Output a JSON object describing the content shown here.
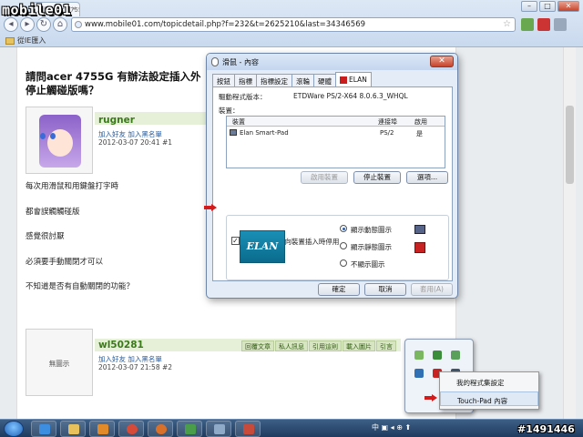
{
  "browser": {
    "logo_text": "mobile01",
    "tab_title": "請問acer 4755G 有辦法...",
    "address": "www.mobile01.com/topicdetail.php?f=232&t=2625210&last=34346569",
    "bookmark": "從IE匯入",
    "controls": {
      "minimize": "–",
      "maximize": "□",
      "close": "✕"
    }
  },
  "post": {
    "title_line1": "請問acer 4755G 有辦法設定插入外",
    "title_line2": "停止觸碰版嗎？",
    "first": {
      "username": "rugner",
      "links": "加入好友  加入黑名單",
      "meta": "2012-03-07 20:41 #1"
    },
    "body": [
      "每次用滑鼠和用鍵盤打字時",
      "都會誤觸觸碰版",
      "感覺很討厭",
      "必須要手動關閉才可以",
      "不知道是否有自動關閉的功能？"
    ],
    "second": {
      "username": "wl50281",
      "links": "加入好友  加入黑名單",
      "meta": "2012-03-07 21:58 #2",
      "no_avatar": "無圖示",
      "actions": [
        "回覆文章",
        "私人訊息",
        "引用這則",
        "載入圖片",
        "引言"
      ]
    }
  },
  "dialog": {
    "title": "滑鼠 - 內容",
    "tabs": [
      "按鈕",
      "指標",
      "指標設定",
      "滾輪",
      "硬體",
      "ELAN"
    ],
    "active_tab": "ELAN",
    "driver_label": "驅動程式版本：",
    "driver_value": "ETDWare PS/2-X64 8.0.6.3_WHQL",
    "devices_label": "裝置：",
    "columns": [
      "裝置",
      "連接埠",
      "啟用"
    ],
    "device": {
      "name": "Elan Smart-Pad",
      "port": "PS/2",
      "enabled": "是"
    },
    "buttons": {
      "enable": "啟用裝置",
      "stop": "停止裝置",
      "options": "選項..."
    },
    "checkbox_label": "當外部USB指向裝置插入時停用",
    "checkbox_checked": true,
    "brand": "ELAN",
    "radios": [
      "顯示動態圖示",
      "顯示靜態圖示",
      "不顯示圖示"
    ],
    "selected_radio": 0,
    "ok": "確定",
    "cancel": "取消",
    "apply": "套用(A)"
  },
  "tray_menu": {
    "items": [
      "我的程式集設定",
      "Touch-Pad 內容"
    ]
  },
  "taskbar": {
    "tray_text": "中 ▣ ◂ ⊕ ⬆",
    "watermark": "#1491446"
  }
}
